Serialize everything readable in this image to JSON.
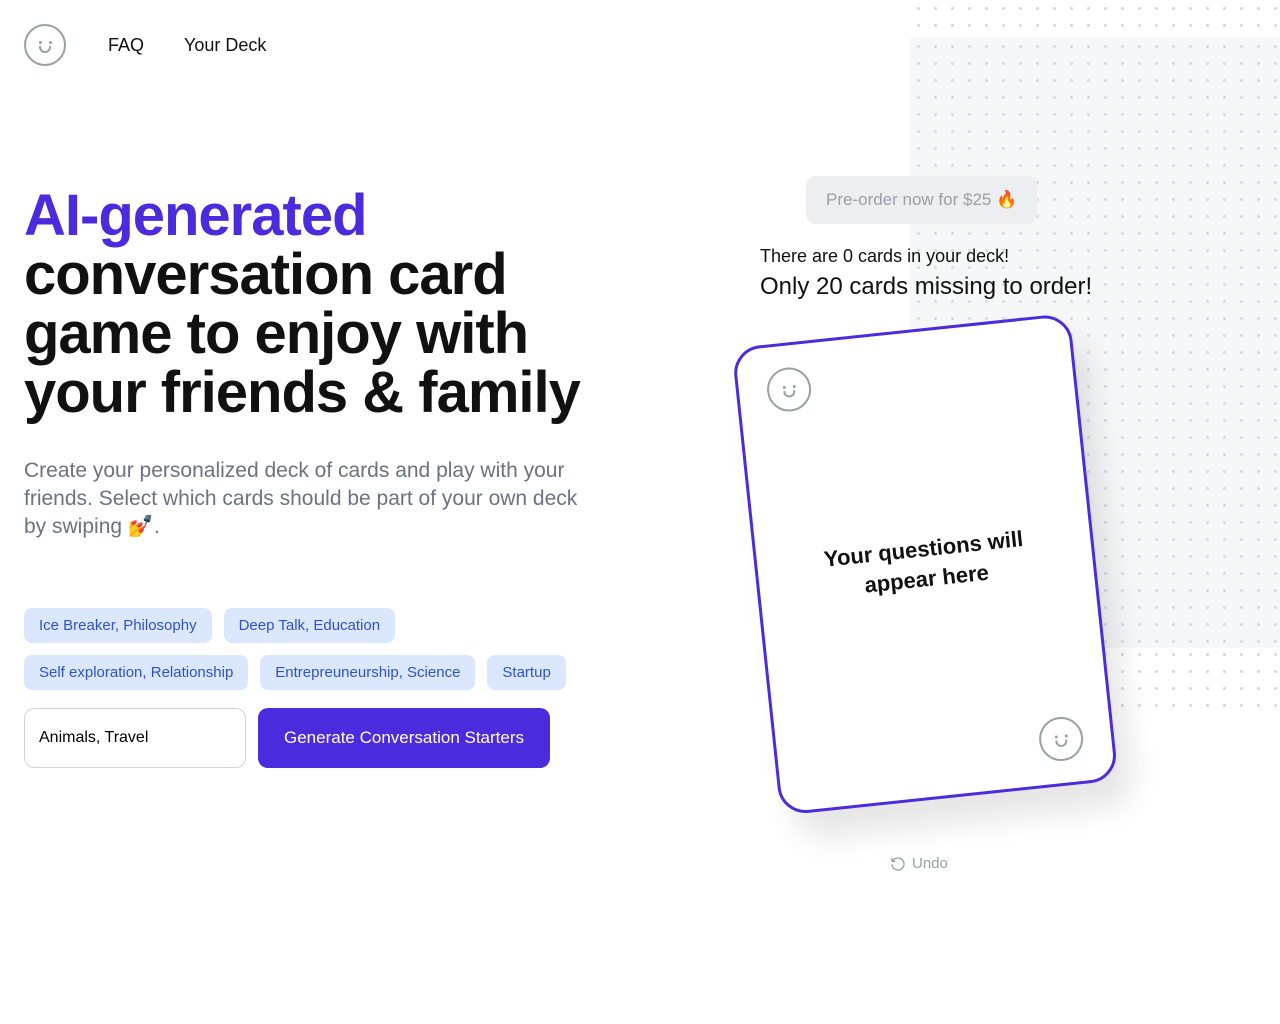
{
  "nav": {
    "faq": "FAQ",
    "deck": "Your Deck"
  },
  "hero": {
    "title_accent": "AI-generated",
    "title_rest": "conversation card game to enjoy with your friends & family",
    "subtitle": "Create your personalized deck of cards and play with your friends. Select which cards should be part of your own deck by swiping 💅."
  },
  "tags": [
    "Ice Breaker, Philosophy",
    "Deep Talk, Education",
    "Self exploration, Relationship",
    "Entrepreuneurship, Science",
    "Startup"
  ],
  "input": {
    "placeholder": "Animals, Travel",
    "value": "Animals, Travel"
  },
  "actions": {
    "generate": "Generate Conversation Starters"
  },
  "right": {
    "preorder": "Pre-order now for $25 🔥",
    "status": "There are 0 cards in your deck!",
    "missing": "Only 20 cards missing to order!",
    "card_text": "Your questions will appear here",
    "undo": "Undo"
  }
}
